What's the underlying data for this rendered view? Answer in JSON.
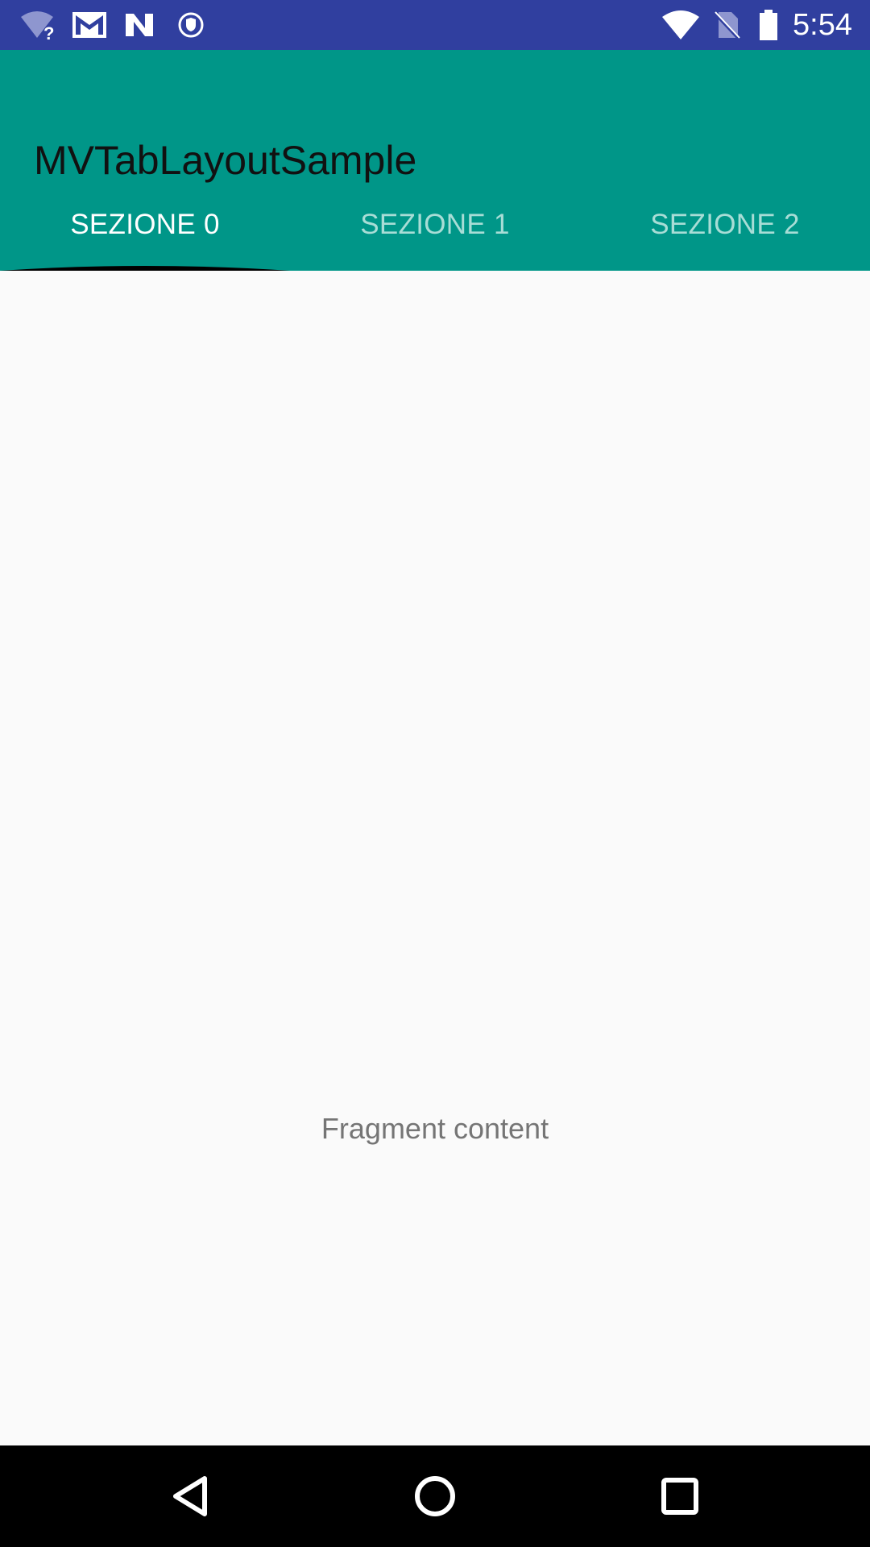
{
  "status_bar": {
    "time": "5:54",
    "left_icons": [
      "wifi-question-icon",
      "gmail-icon",
      "n-app-icon",
      "shield-icon"
    ],
    "right_icons": [
      "wifi-icon",
      "no-sim-icon",
      "battery-icon"
    ],
    "color": "#303f9f"
  },
  "app_bar": {
    "title": "MVTabLayoutSample",
    "color": "#009688"
  },
  "tabs": [
    {
      "label": "SEZIONE 0",
      "selected": true
    },
    {
      "label": "SEZIONE 1",
      "selected": false
    },
    {
      "label": "SEZIONE 2",
      "selected": false
    }
  ],
  "content": {
    "text": "Fragment content"
  },
  "nav_bar": {
    "buttons": [
      "back-icon",
      "home-icon",
      "recents-icon"
    ]
  }
}
